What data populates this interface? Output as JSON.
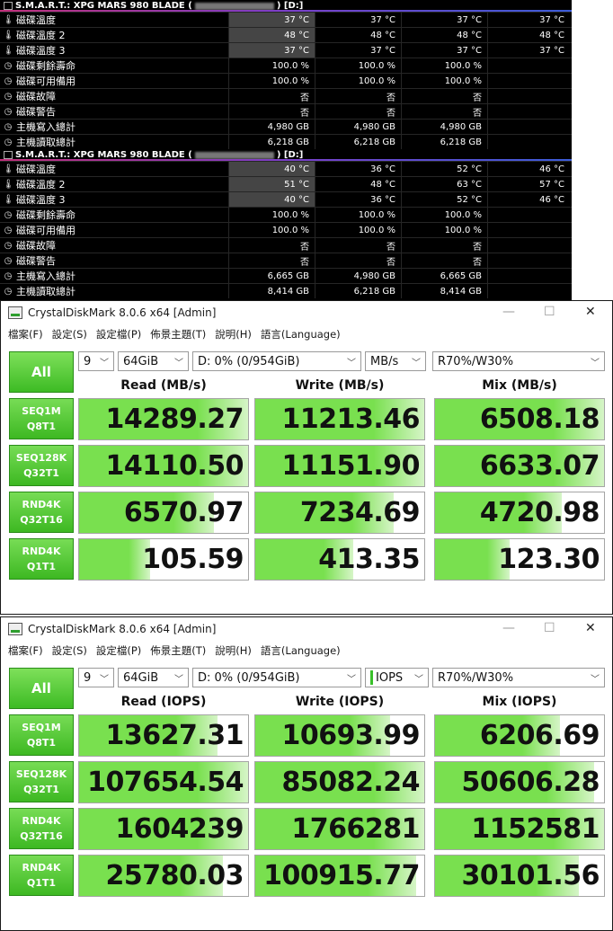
{
  "hwinfo": {
    "sections": [
      {
        "header": {
          "prefix": "S.M.A.R.T.: XPG MARS 980 BLADE (",
          "suffix": ") [D:]"
        },
        "rows": [
          {
            "icon": "thermometer-icon",
            "label": "磁碟溫度",
            "values": [
              "37 °C",
              "37 °C",
              "37 °C",
              "37 °C"
            ],
            "hl": true
          },
          {
            "icon": "thermometer-icon",
            "label": "磁碟溫度 2",
            "values": [
              "48 °C",
              "48 °C",
              "48 °C",
              "48 °C"
            ],
            "hl": true
          },
          {
            "icon": "thermometer-icon",
            "label": "磁碟溫度 3",
            "values": [
              "37 °C",
              "37 °C",
              "37 °C",
              "37 °C"
            ],
            "hl": true
          },
          {
            "icon": "clock-icon",
            "label": "磁碟剩餘壽命",
            "values": [
              "100.0 %",
              "100.0 %",
              "100.0 %",
              ""
            ],
            "hl": false
          },
          {
            "icon": "clock-icon",
            "label": "磁碟可用備用",
            "values": [
              "100.0 %",
              "100.0 %",
              "100.0 %",
              ""
            ],
            "hl": false
          },
          {
            "icon": "clock-icon",
            "label": "磁碟故障",
            "values": [
              "否",
              "否",
              "否",
              ""
            ],
            "hl": false
          },
          {
            "icon": "clock-icon",
            "label": "磁碟警告",
            "values": [
              "否",
              "否",
              "否",
              ""
            ],
            "hl": false
          },
          {
            "icon": "clock-icon",
            "label": "主機寫入總計",
            "values": [
              "4,980 GB",
              "4,980 GB",
              "4,980 GB",
              ""
            ],
            "hl": false
          },
          {
            "icon": "clock-icon",
            "label": "主機讀取總計",
            "values": [
              "6,218 GB",
              "6,218 GB",
              "6,218 GB",
              ""
            ],
            "hl": false
          }
        ]
      },
      {
        "header": {
          "prefix": "S.M.A.R.T.: XPG MARS 980 BLADE (",
          "suffix": ") [D:]"
        },
        "rows": [
          {
            "icon": "thermometer-icon",
            "label": "磁碟溫度",
            "values": [
              "40 °C",
              "36 °C",
              "52 °C",
              "46 °C"
            ],
            "hl": true
          },
          {
            "icon": "thermometer-icon",
            "label": "磁碟溫度 2",
            "values": [
              "51 °C",
              "48 °C",
              "63 °C",
              "57 °C"
            ],
            "hl": true
          },
          {
            "icon": "thermometer-icon",
            "label": "磁碟溫度 3",
            "values": [
              "40 °C",
              "36 °C",
              "52 °C",
              "46 °C"
            ],
            "hl": true
          },
          {
            "icon": "clock-icon",
            "label": "磁碟剩餘壽命",
            "values": [
              "100.0 %",
              "100.0 %",
              "100.0 %",
              ""
            ],
            "hl": false
          },
          {
            "icon": "clock-icon",
            "label": "磁碟可用備用",
            "values": [
              "100.0 %",
              "100.0 %",
              "100.0 %",
              ""
            ],
            "hl": false
          },
          {
            "icon": "clock-icon",
            "label": "磁碟故障",
            "values": [
              "否",
              "否",
              "否",
              ""
            ],
            "hl": false
          },
          {
            "icon": "clock-icon",
            "label": "磁碟警告",
            "values": [
              "否",
              "否",
              "否",
              ""
            ],
            "hl": false
          },
          {
            "icon": "clock-icon",
            "label": "主機寫入總計",
            "values": [
              "6,665 GB",
              "4,980 GB",
              "6,665 GB",
              ""
            ],
            "hl": false
          },
          {
            "icon": "clock-icon",
            "label": "主機讀取總計",
            "values": [
              "8,414 GB",
              "6,218 GB",
              "8,414 GB",
              ""
            ],
            "hl": false
          }
        ]
      }
    ]
  },
  "cdm1": {
    "title": "CrystalDiskMark 8.0.6 x64 [Admin]",
    "menu": [
      "檔案(F)",
      "設定(S)",
      "設定檔(P)",
      "佈景主題(T)",
      "說明(H)",
      "語言(Language)"
    ],
    "all_label": "All",
    "count": "9",
    "size": "64GiB",
    "drive": "D: 0% (0/954GiB)",
    "unit": "MB/s",
    "mix": "R70%/W30%",
    "col_read": "Read (MB/s)",
    "col_write": "Write (MB/s)",
    "col_mix": "Mix (MB/s)",
    "rows": [
      {
        "l1": "SEQ1M",
        "l2": "Q8T1",
        "read": "14289.27",
        "write": "11213.46",
        "mix": "6508.18",
        "fill": [
          1.0,
          1.0,
          1.0
        ]
      },
      {
        "l1": "SEQ128K",
        "l2": "Q32T1",
        "read": "14110.50",
        "write": "11151.90",
        "mix": "6633.07",
        "fill": [
          1.0,
          1.0,
          1.0
        ]
      },
      {
        "l1": "RND4K",
        "l2": "Q32T16",
        "read": "6570.97",
        "write": "7234.69",
        "mix": "4720.98",
        "fill": [
          0.8,
          0.82,
          0.75
        ]
      },
      {
        "l1": "RND4K",
        "l2": "Q1T1",
        "read": "105.59",
        "write": "413.35",
        "mix": "123.30",
        "fill": [
          0.42,
          0.58,
          0.44
        ]
      }
    ]
  },
  "cdm2": {
    "title": "CrystalDiskMark 8.0.6 x64 [Admin]",
    "menu": [
      "檔案(F)",
      "設定(S)",
      "設定檔(P)",
      "佈景主題(T)",
      "說明(H)",
      "語言(Language)"
    ],
    "all_label": "All",
    "count": "9",
    "size": "64GiB",
    "drive": "D: 0% (0/954GiB)",
    "unit": "IOPS",
    "mix": "R70%/W30%",
    "col_read": "Read (IOPS)",
    "col_write": "Write (IOPS)",
    "col_mix": "Mix (IOPS)",
    "rows": [
      {
        "l1": "SEQ1M",
        "l2": "Q8T1",
        "read": "13627.31",
        "write": "10693.99",
        "mix": "6206.69",
        "fill": [
          0.82,
          0.8,
          0.74
        ]
      },
      {
        "l1": "SEQ128K",
        "l2": "Q32T1",
        "read": "107654.54",
        "write": "85082.24",
        "mix": "50606.28",
        "fill": [
          1.0,
          1.0,
          0.94
        ]
      },
      {
        "l1": "RND4K",
        "l2": "Q32T16",
        "read": "1604239",
        "write": "1766281",
        "mix": "1152581",
        "fill": [
          1.0,
          1.0,
          1.0
        ]
      },
      {
        "l1": "RND4K",
        "l2": "Q1T1",
        "read": "25780.03",
        "write": "100915.77",
        "mix": "30101.56",
        "fill": [
          0.85,
          0.95,
          0.85
        ]
      }
    ]
  }
}
